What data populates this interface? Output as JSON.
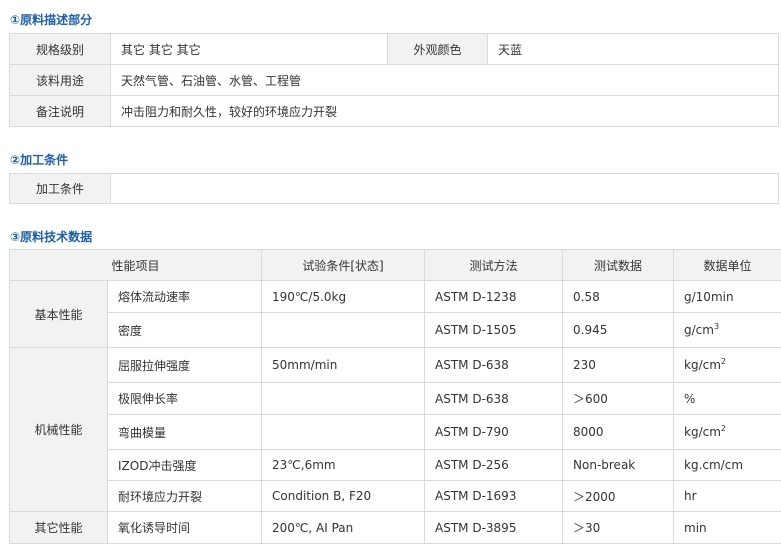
{
  "section1": {
    "title": "①原料描述部分",
    "spec_label": "规格级别",
    "spec_value": "其它 其它 其它",
    "color_label": "外观颜色",
    "color_value": "天蓝",
    "usage_label": "该料用途",
    "usage_value": "天然气管、石油管、水管、工程管",
    "notes_label": "备注说明",
    "notes_value": "冲击阻力和耐久性，较好的环境应力开裂"
  },
  "section2": {
    "title": "②加工条件",
    "cond_label": "加工条件",
    "cond_value": ""
  },
  "section3": {
    "title": "③原料技术数据",
    "headers": [
      "性能项目",
      "试验条件[状态]",
      "测试方法",
      "测试数据",
      "数据单位"
    ],
    "groups": {
      "basic": "基本性能",
      "mechanical": "机械性能",
      "other": "其它性能"
    },
    "rows": [
      {
        "item": "熔体流动速率",
        "cond": "190℃/5.0kg",
        "method": "ASTM D-1238",
        "value": "0.58",
        "unit": "g/10min"
      },
      {
        "item": "密度",
        "cond": "",
        "method": "ASTM D-1505",
        "value": "0.945",
        "unit": "g/cm",
        "sup": "3"
      },
      {
        "item": "屈服拉伸强度",
        "cond": "50mm/min",
        "method": "ASTM D-638",
        "value": "230",
        "unit": "kg/cm",
        "sup": "2"
      },
      {
        "item": "极限伸长率",
        "cond": "",
        "method": "ASTM D-638",
        "value": "＞600",
        "unit": "%"
      },
      {
        "item": "弯曲模量",
        "cond": "",
        "method": "ASTM D-790",
        "value": "8000",
        "unit": "kg/cm",
        "sup": "2"
      },
      {
        "item": "IZOD冲击强度",
        "cond": "23℃,6mm",
        "method": "ASTM D-256",
        "value": "Non-break",
        "unit": "kg.cm/cm"
      },
      {
        "item": "耐环境应力开裂",
        "cond": "Condition B, F20",
        "method": "ASTM D-1693",
        "value": "＞2000",
        "unit": "hr"
      },
      {
        "item": "氧化诱导时间",
        "cond": "200℃, AI Pan",
        "method": "ASTM D-3895",
        "value": "＞30",
        "unit": "min"
      }
    ]
  }
}
